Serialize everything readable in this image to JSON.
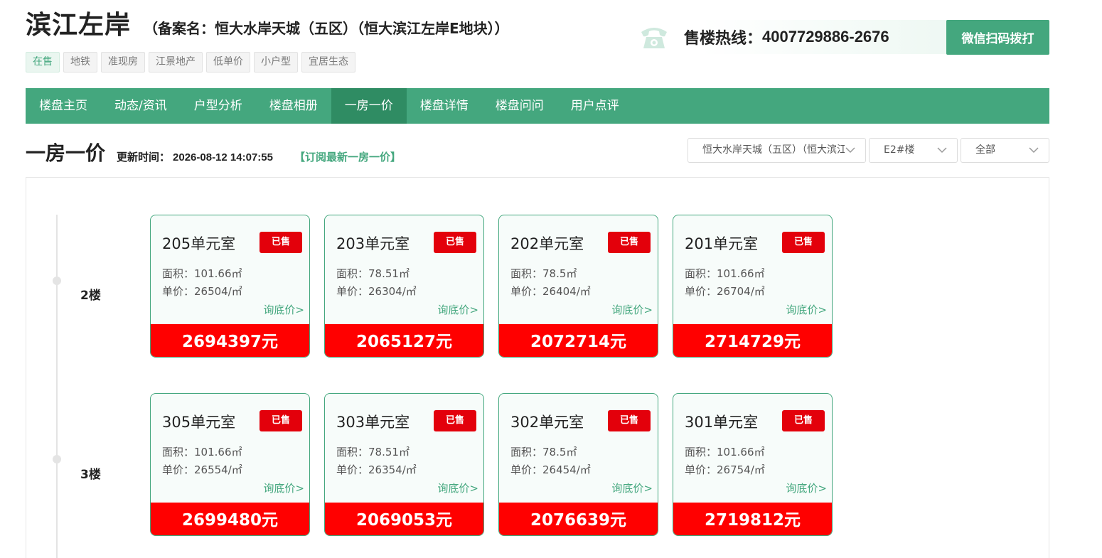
{
  "header": {
    "project_name": "滨江左岸",
    "record_name": "（备案名：恒大水岸天城（五区）（恒大滨江左岸E地块））",
    "tags": [
      {
        "label": "在售",
        "active": true
      },
      {
        "label": "地铁",
        "active": false
      },
      {
        "label": "准现房",
        "active": false
      },
      {
        "label": "江景地产",
        "active": false
      },
      {
        "label": "低单价",
        "active": false
      },
      {
        "label": "小户型",
        "active": false
      },
      {
        "label": "宜居生态",
        "active": false
      }
    ],
    "hotline_label": "售楼热线：",
    "hotline_number": "4007729886-2676",
    "wechat_button": "微信扫码拨打",
    "phone_icon": "telephone-icon"
  },
  "nav": {
    "items": [
      "楼盘主页",
      "动态/资讯",
      "户型分析",
      "楼盘相册",
      "一房一价",
      "楼盘详情",
      "楼盘问问",
      "用户点评"
    ],
    "active": "一房一价"
  },
  "section": {
    "title": "一房一价",
    "update_label": "更新时间：",
    "update_time": "2026-08-12 14:07:55",
    "subscribe": "【订阅最新一房一价】"
  },
  "filters": {
    "project": "恒大水岸天城（五区）（恒大滨江左岸E地块）",
    "building": "E2#楼",
    "status": "全部",
    "chevron_icon": "chevron-down-icon"
  },
  "floors": [
    {
      "label": "2楼",
      "units": [
        {
          "room": "205单元室",
          "status": "已售",
          "area": "面积：101.66㎡",
          "unit_price": "单价：26504/㎡",
          "ask": "询底价>",
          "total": "2694397元"
        },
        {
          "room": "203单元室",
          "status": "已售",
          "area": "面积：78.51㎡",
          "unit_price": "单价：26304/㎡",
          "ask": "询底价>",
          "total": "2065127元"
        },
        {
          "room": "202单元室",
          "status": "已售",
          "area": "面积：78.5㎡",
          "unit_price": "单价：26404/㎡",
          "ask": "询底价>",
          "total": "2072714元"
        },
        {
          "room": "201单元室",
          "status": "已售",
          "area": "面积：101.66㎡",
          "unit_price": "单价：26704/㎡",
          "ask": "询底价>",
          "total": "2714729元"
        }
      ]
    },
    {
      "label": "3楼",
      "units": [
        {
          "room": "305单元室",
          "status": "已售",
          "area": "面积：101.66㎡",
          "unit_price": "单价：26554/㎡",
          "ask": "询底价>",
          "total": "2699480元"
        },
        {
          "room": "303单元室",
          "status": "已售",
          "area": "面积：78.51㎡",
          "unit_price": "单价：26354/㎡",
          "ask": "询底价>",
          "total": "2069053元"
        },
        {
          "room": "302单元室",
          "status": "已售",
          "area": "面积：78.5㎡",
          "unit_price": "单价：26454/㎡",
          "ask": "询底价>",
          "total": "2076639元"
        },
        {
          "room": "301单元室",
          "status": "已售",
          "area": "面积：101.66㎡",
          "unit_price": "单价：26754/㎡",
          "ask": "询底价>",
          "total": "2719812元"
        }
      ]
    }
  ],
  "colors": {
    "brand_green": "#44a77e",
    "nav_active": "#2f8c63",
    "sold_red": "#e3000b",
    "price_red": "#ff0000"
  }
}
